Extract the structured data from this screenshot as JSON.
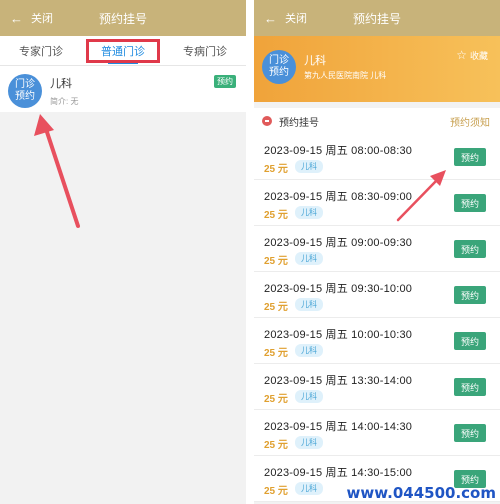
{
  "left": {
    "header": {
      "back_label": "关闭",
      "title": "预约挂号"
    },
    "tabs": [
      {
        "label": "专家门诊"
      },
      {
        "label": "普通门诊"
      },
      {
        "label": "专病门诊"
      }
    ],
    "dept": {
      "avatar_text": "门诊预约",
      "name": "儿科",
      "intro": "简介: 无",
      "badge": "预约"
    }
  },
  "right": {
    "header": {
      "back_label": "关闭",
      "title": "预约挂号"
    },
    "banner": {
      "avatar_text": "门诊预约",
      "dept": "儿科",
      "hospital": "第九人民医院南院  儿科",
      "favorite": "收藏"
    },
    "section": {
      "title": "预约挂号",
      "notice": "预约须知"
    },
    "slots": [
      {
        "datetime": "2023-09-15  周五  08:00-08:30",
        "price": "25 元",
        "dept": "儿科",
        "button": "预约"
      },
      {
        "datetime": "2023-09-15  周五  08:30-09:00",
        "price": "25 元",
        "dept": "儿科",
        "button": "预约"
      },
      {
        "datetime": "2023-09-15  周五  09:00-09:30",
        "price": "25 元",
        "dept": "儿科",
        "button": "预约"
      },
      {
        "datetime": "2023-09-15  周五  09:30-10:00",
        "price": "25 元",
        "dept": "儿科",
        "button": "预约"
      },
      {
        "datetime": "2023-09-15  周五  10:00-10:30",
        "price": "25 元",
        "dept": "儿科",
        "button": "预约"
      },
      {
        "datetime": "2023-09-15  周五  13:30-14:00",
        "price": "25 元",
        "dept": "儿科",
        "button": "预约"
      },
      {
        "datetime": "2023-09-15  周五  14:00-14:30",
        "price": "25 元",
        "dept": "儿科",
        "button": "预约"
      },
      {
        "datetime": "2023-09-15  周五  14:30-15:00",
        "price": "25 元",
        "dept": "儿科",
        "button": "预约"
      }
    ]
  },
  "watermark": "www.044500.com",
  "colors": {
    "header": "#c8b37a",
    "accent": "#1f8be0",
    "highlight_box": "#e0394a",
    "book_button": "#3aa57a",
    "price": "#e0a030"
  }
}
